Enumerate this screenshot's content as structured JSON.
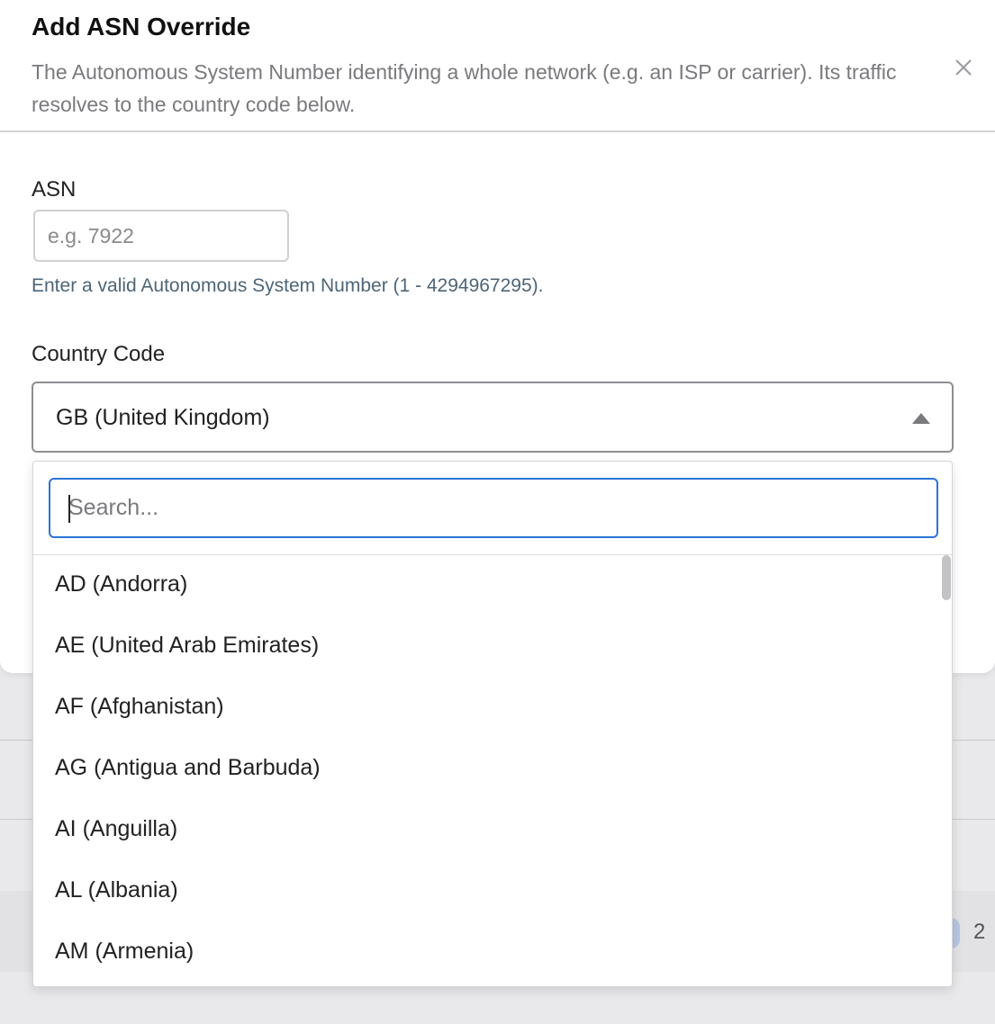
{
  "modal": {
    "title": "Add ASN Override",
    "description": "The Autonomous System Number identifying a whole network (e.g. an ISP or carrier). Its traffic resolves to the country code below.",
    "close_icon": "close-icon"
  },
  "asn_field": {
    "label": "ASN",
    "placeholder": "e.g. 7922",
    "value": "",
    "hint": "Enter a valid Autonomous System Number (1 - 4294967295)."
  },
  "country_field": {
    "label": "Country Code",
    "selected": "GB (United Kingdom)",
    "caret_icon": "caret-up-icon"
  },
  "dropdown": {
    "search_placeholder": "Search...",
    "search_value": "",
    "options": [
      {
        "label": "AD (Andorra)"
      },
      {
        "label": "AE (United Arab Emirates)"
      },
      {
        "label": "AF (Afghanistan)"
      },
      {
        "label": "AG (Antigua and Barbuda)"
      },
      {
        "label": "AI (Anguilla)"
      },
      {
        "label": "AL (Albania)"
      },
      {
        "label": "AM (Armenia)"
      }
    ]
  },
  "background": {
    "count": "2"
  },
  "colors": {
    "accent": "#2b74d6",
    "hint": "#4d6577",
    "muted_text": "#7a7a7e"
  }
}
